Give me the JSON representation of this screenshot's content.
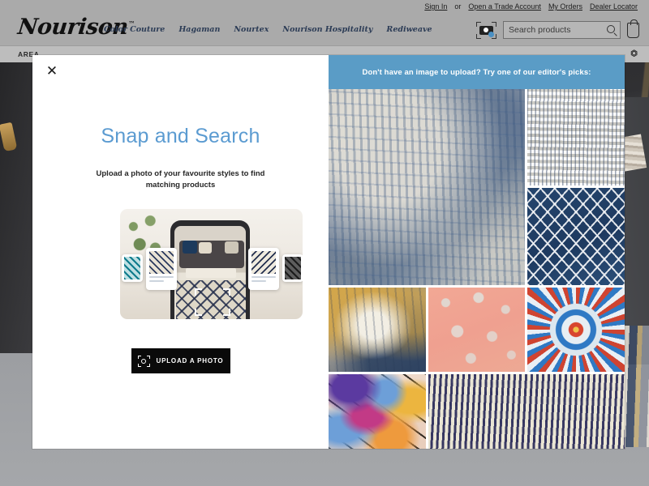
{
  "header": {
    "brand": "Nourison",
    "brand_tm": "™",
    "account_links": [
      {
        "label": "Sign In"
      },
      {
        "label": "or",
        "plain": true
      },
      {
        "label": "Open a Trade Account"
      },
      {
        "label": "My Orders"
      },
      {
        "label": "Dealer Locator"
      }
    ],
    "brand_nav": [
      "Color Couture",
      "Hagaman",
      "Nourtex",
      "Nourison Hospitality",
      "Rediweave"
    ],
    "search": {
      "placeholder": "Search products",
      "value": "",
      "camera_icon": "visual-search-camera-icon",
      "magnifier_icon": "search-icon"
    },
    "cart_icon": "shopping-bag-icon"
  },
  "subnav": {
    "label": "AREA",
    "share_icon": "share-icon"
  },
  "modal": {
    "close_icon": "close-icon",
    "close_label": "✕",
    "title": "Snap and Search",
    "subtitle": "Upload a photo of your favourite styles to find matching products",
    "illustration_name": "snap-and-search-illustration",
    "upload_button": {
      "label": "UPLOAD A PHOTO",
      "icon": "camera-scan-icon"
    }
  },
  "picks": {
    "banner": "Don't have an image to upload? Try one of our editor's picks:",
    "banner_color": "#5a9cc6",
    "items": [
      {
        "name": "pick-abstract-blue-grey",
        "texture": "t-abstract-blue"
      },
      {
        "name": "pick-ivory-stripe",
        "texture": "t-stripe-ivory"
      },
      {
        "name": "pick-navy-trellis",
        "texture": "t-trellis-navy"
      },
      {
        "name": "pick-gold-abstract",
        "texture": "t-gold-abstract"
      },
      {
        "name": "pick-blush-floral",
        "texture": "t-blush-floral"
      },
      {
        "name": "pick-blue-medallion",
        "texture": "t-medallion"
      },
      {
        "name": "pick-multicolor-swirl",
        "texture": "t-swirl-bright"
      },
      {
        "name": "pick-navy-ikat",
        "texture": "t-ikat-navy"
      }
    ]
  },
  "colors": {
    "accent_blue": "#5b9bd1",
    "banner_blue": "#5a9cc6",
    "header_grey": "#aaaaaa",
    "button_black": "#0a0a0a"
  }
}
